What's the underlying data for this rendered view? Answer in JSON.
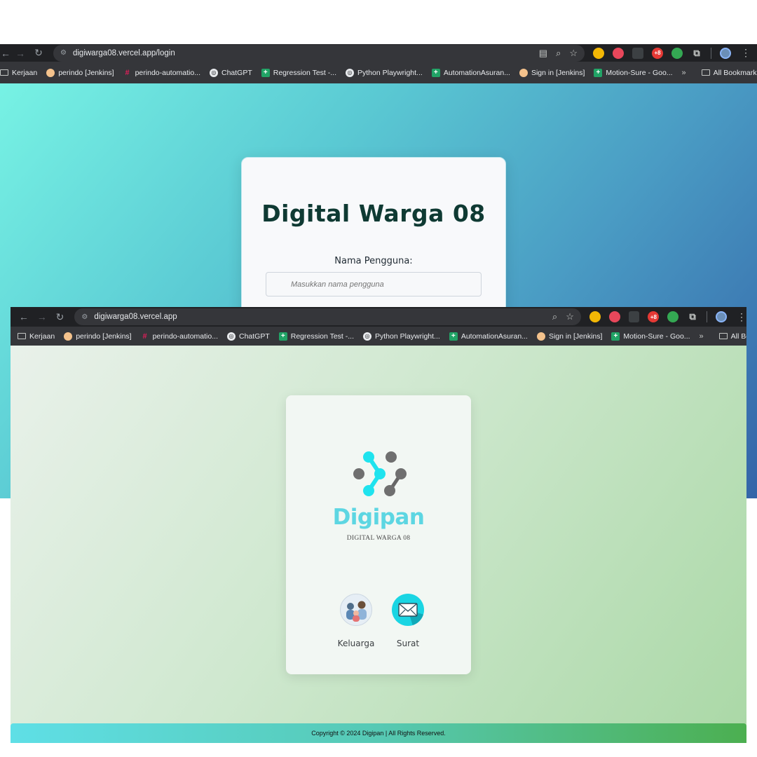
{
  "login_window": {
    "url": "digiwarga08.vercel.app/login",
    "title": "Digital Warga 08",
    "username_label": "Nama Pengguna:",
    "username_placeholder": "Masukkan nama pengguna",
    "background_colors": [
      "#77f2e4",
      "#3464a8"
    ]
  },
  "dashboard_window": {
    "url": "digiwarga08.vercel.app",
    "brand_name": "Digipan",
    "brand_subtitle": "DIGITAL WARGA 08",
    "menu": [
      {
        "label": "Keluarga",
        "icon": "family-icon"
      },
      {
        "label": "Surat",
        "icon": "mail-icon"
      }
    ],
    "footer": "Copyright © 2024 Digipan | All Rights Reserved.",
    "brand_color": "#5dd6e2",
    "background_colors": [
      "#e9f1ea",
      "#aad8a6"
    ]
  },
  "bookmarks": [
    {
      "label": "Kerjaan",
      "icon": "folder-icon"
    },
    {
      "label": "perindo [Jenkins]",
      "icon": "jenkins-icon"
    },
    {
      "label": "perindo-automatio...",
      "icon": "slack-icon"
    },
    {
      "label": "ChatGPT",
      "icon": "chatgpt-icon"
    },
    {
      "label": "Regression Test -...",
      "icon": "sheets-icon"
    },
    {
      "label": "Python Playwright...",
      "icon": "chatgpt-icon"
    },
    {
      "label": "AutomationAsuran...",
      "icon": "sheets-icon"
    },
    {
      "label": "Sign in [Jenkins]",
      "icon": "jenkins-icon"
    },
    {
      "label": "Motion-Sure - Goo...",
      "icon": "sheets-icon"
    }
  ],
  "all_bookmarks_label": "All Bookmarks",
  "more_bookmarks_glyph": "»"
}
